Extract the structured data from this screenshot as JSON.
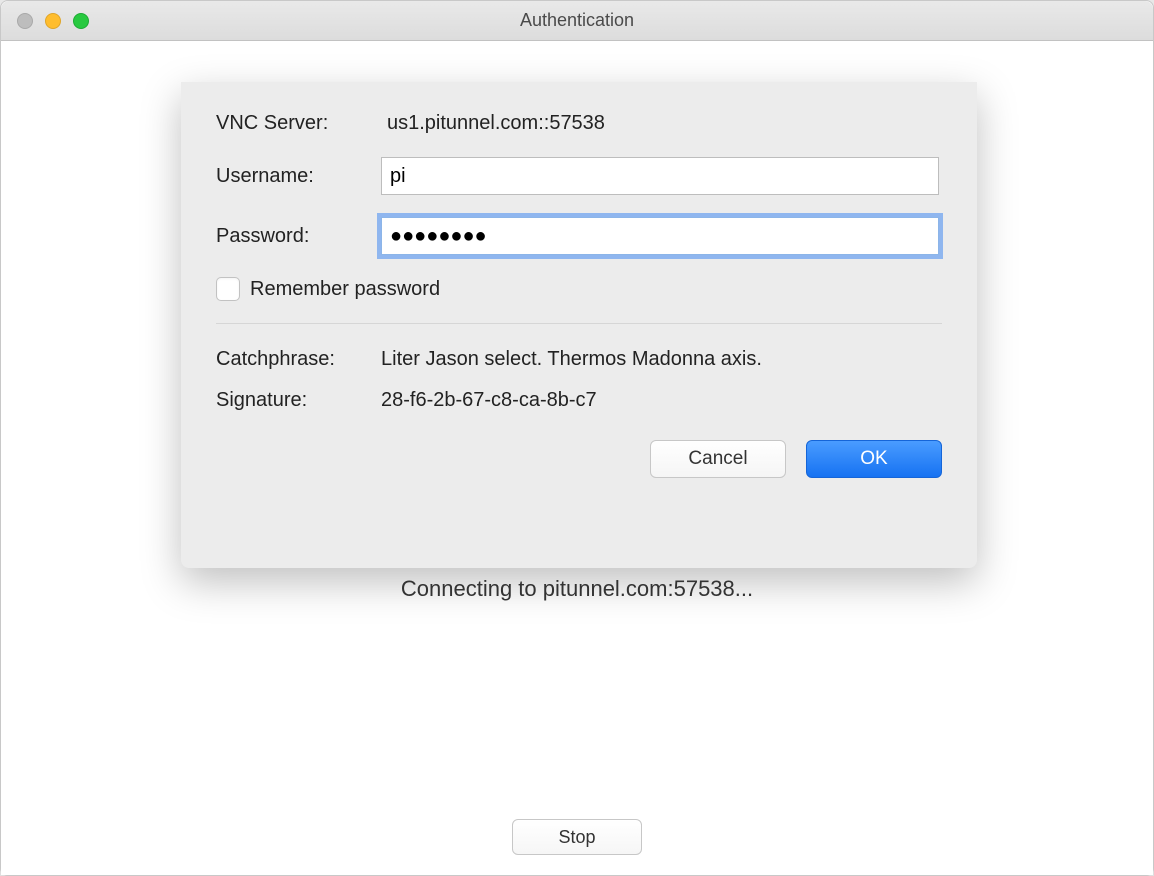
{
  "window": {
    "title": "Authentication"
  },
  "status": {
    "connecting_text": "Connecting to pitunnel.com:57538...",
    "stop_label": "Stop"
  },
  "auth": {
    "vnc_server_label": "VNC Server:",
    "vnc_server_value": "us1.pitunnel.com::57538",
    "username_label": "Username:",
    "username_value": "pi",
    "password_label": "Password:",
    "password_value": "●●●●●●●●",
    "remember_label": "Remember password",
    "catchphrase_label": "Catchphrase:",
    "catchphrase_value": "Liter Jason select. Thermos Madonna axis.",
    "signature_label": "Signature:",
    "signature_value": "28-f6-2b-67-c8-ca-8b-c7",
    "cancel_label": "Cancel",
    "ok_label": "OK"
  }
}
